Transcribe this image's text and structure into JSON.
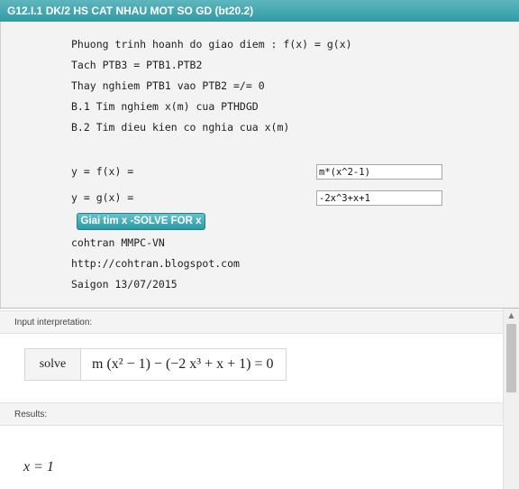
{
  "window": {
    "title": "G12.I.1 DK/2 HS CAT NHAU MOT SO GD (bt20.2)"
  },
  "form": {
    "instructions": [
      "Phuong trinh hoanh do giao diem : f(x) = g(x)",
      "Tach PTB3 = PTB1.PTB2",
      "Thay nghiem PTB1 vao PTB2 =/= 0",
      "B.1 Tim nghiem x(m) cua PTHDGD",
      "B.2 Tim dieu kien co nghia cua x(m)"
    ],
    "f_label": "y = f(x) =",
    "f_value": "m*(x^2-1)",
    "g_label": "y = g(x) =",
    "g_value": "-2x^3+x+1",
    "solve_button": "Giai tim x -SOLVE FOR x",
    "credits": [
      "cohtran MMPC-VN",
      "http://cohtran.blogspot.com",
      "Saigon 13/07/2015"
    ]
  },
  "results": {
    "interpretation_title": "Input interpretation:",
    "interpretation_key": "solve",
    "interpretation_expr": "m (x² − 1) − (−2 x³ + x + 1) = 0",
    "results_title": "Results:",
    "result_value": "x = 1"
  },
  "colors": {
    "accent": "#3aa6ae",
    "button": "#2b9aa6"
  },
  "icons": {
    "scroll_up": "triangle-up",
    "scroll_down": "triangle-down"
  }
}
